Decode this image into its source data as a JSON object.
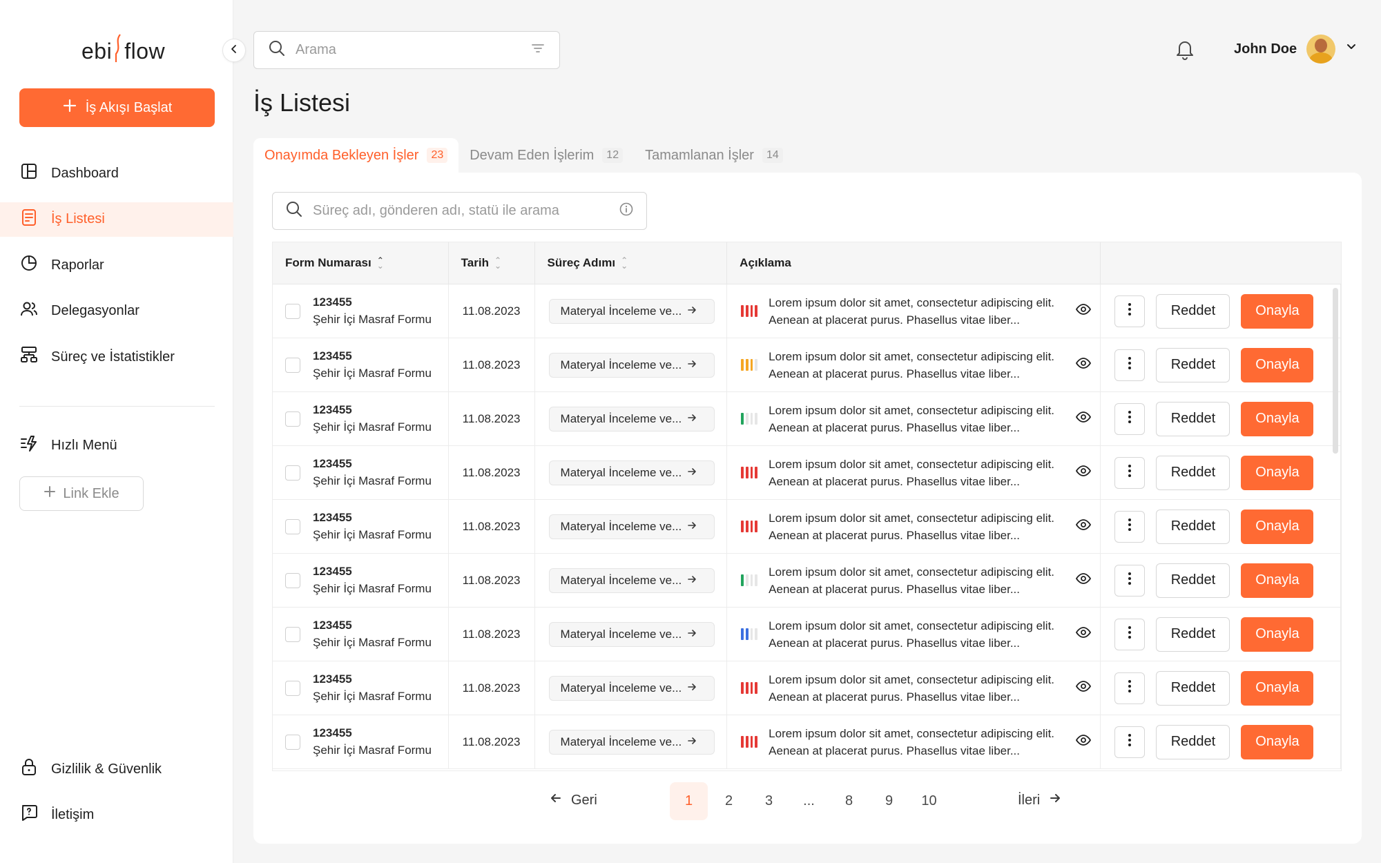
{
  "brand": {
    "logo_left": "ebi",
    "logo_right": "flow"
  },
  "sidebar": {
    "start_button": "İş Akışı Başlat",
    "items": [
      {
        "label": "Dashboard",
        "icon": "dashboard-icon"
      },
      {
        "label": "İş Listesi",
        "icon": "task-list-icon",
        "active": true
      },
      {
        "label": "Raporlar",
        "icon": "pie-chart-icon"
      },
      {
        "label": "Delegasyonlar",
        "icon": "users-icon"
      },
      {
        "label": "Süreç ve İstatistikler",
        "icon": "workflow-icon"
      }
    ],
    "quick_menu": "Hızlı Menü",
    "link_add": "Link Ekle",
    "bottom": [
      {
        "label": "Gizlilik & Güvenlik",
        "icon": "lock-icon"
      },
      {
        "label": "İletişim",
        "icon": "chat-icon"
      }
    ]
  },
  "header": {
    "search_placeholder": "Arama",
    "user_name": "John Doe"
  },
  "page": {
    "title": "İş Listesi",
    "tabs": [
      {
        "label": "Onayımda Bekleyen İşler",
        "count": "23",
        "active": true
      },
      {
        "label": "Devam Eden İşlerim",
        "count": "12"
      },
      {
        "label": "Tamamlanan İşler",
        "count": "14"
      }
    ],
    "table_search_placeholder": "Süreç adı, gönderen adı, statü ile arama"
  },
  "table": {
    "columns": [
      "Form Numarası",
      "Tarih",
      "Süreç Adımı",
      "Açıklama"
    ],
    "rows": [
      {
        "number": "123455",
        "form": "Şehir İçi Masraf Formu",
        "date": "11.08.2023",
        "step": "Materyal İnceleme ve...",
        "priority": "high",
        "description": "Lorem ipsum dolor sit amet, consectetur adipiscing elit. Aenean at placerat purus. Phasellus vitae liber..."
      },
      {
        "number": "123455",
        "form": "Şehir İçi Masraf Formu",
        "date": "11.08.2023",
        "step": "Materyal İnceleme ve...",
        "priority": "medium",
        "description": "Lorem ipsum dolor sit amet, consectetur adipiscing elit. Aenean at placerat purus. Phasellus vitae liber..."
      },
      {
        "number": "123455",
        "form": "Şehir İçi Masraf Formu",
        "date": "11.08.2023",
        "step": "Materyal İnceleme ve...",
        "priority": "low",
        "description": "Lorem ipsum dolor sit amet, consectetur adipiscing elit. Aenean at placerat purus. Phasellus vitae liber..."
      },
      {
        "number": "123455",
        "form": "Şehir İçi Masraf Formu",
        "date": "11.08.2023",
        "step": "Materyal İnceleme ve...",
        "priority": "high",
        "description": "Lorem ipsum dolor sit amet, consectetur adipiscing elit. Aenean at placerat purus. Phasellus vitae liber..."
      },
      {
        "number": "123455",
        "form": "Şehir İçi Masraf Formu",
        "date": "11.08.2023",
        "step": "Materyal İnceleme ve...",
        "priority": "high",
        "description": "Lorem ipsum dolor sit amet, consectetur adipiscing elit. Aenean at placerat purus. Phasellus vitae liber..."
      },
      {
        "number": "123455",
        "form": "Şehir İçi Masraf Formu",
        "date": "11.08.2023",
        "step": "Materyal İnceleme ve...",
        "priority": "low",
        "description": "Lorem ipsum dolor sit amet, consectetur adipiscing elit. Aenean at placerat purus. Phasellus vitae liber..."
      },
      {
        "number": "123455",
        "form": "Şehir İçi Masraf Formu",
        "date": "11.08.2023",
        "step": "Materyal İnceleme ve...",
        "priority": "info",
        "description": "Lorem ipsum dolor sit amet, consectetur adipiscing elit. Aenean at placerat purus. Phasellus vitae liber..."
      },
      {
        "number": "123455",
        "form": "Şehir İçi Masraf Formu",
        "date": "11.08.2023",
        "step": "Materyal İnceleme ve...",
        "priority": "high",
        "description": "Lorem ipsum dolor sit amet, consectetur adipiscing elit. Aenean at placerat purus. Phasellus vitae liber..."
      },
      {
        "number": "123455",
        "form": "Şehir İçi Masraf Formu",
        "date": "11.08.2023",
        "step": "Materyal İnceleme ve...",
        "priority": "high",
        "description": "Lorem ipsum dolor sit amet, consectetur adipiscing elit. Aenean at placerat purus. Phasellus vitae liber..."
      }
    ],
    "actions": {
      "reject": "Reddet",
      "approve": "Onayla"
    }
  },
  "pagination": {
    "prev": "Geri",
    "next": "İleri",
    "pages": [
      "1",
      "2",
      "3",
      "...",
      "8",
      "9",
      "10"
    ],
    "current": "1"
  },
  "colors": {
    "accent": "#ff6a33",
    "high": "#e53935",
    "medium": "#f5a623",
    "low": "#22a45d",
    "info": "#3b6fe0",
    "empty": "#e6e6e6"
  }
}
